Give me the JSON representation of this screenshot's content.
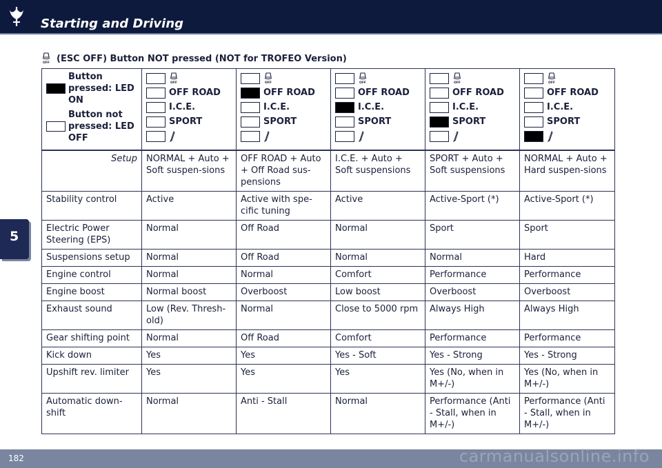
{
  "header": {
    "title": "Starting and Driving",
    "logo_icon": "trident-logo-icon"
  },
  "chapter": {
    "number": "5"
  },
  "footer": {
    "page_number": "182",
    "watermark": "carmanualsonline.info"
  },
  "section": {
    "heading": "(ESC OFF) Button NOT pressed (NOT for TROFEO Version)",
    "icon": "esc-off-icon"
  },
  "legend": {
    "pressed_label": "Button pressed: LED ON",
    "not_pressed_label": "Button not pressed: LED OFF"
  },
  "button_labels": {
    "off_road": "OFF ROAD",
    "ice": "I.C.E.",
    "sport": "SPORT"
  },
  "modes": [
    {
      "active": "none"
    },
    {
      "active": "off_road"
    },
    {
      "active": "ice"
    },
    {
      "active": "sport"
    },
    {
      "active": "suspension"
    }
  ],
  "table": {
    "rows": [
      {
        "label": "Setup",
        "cells": [
          "NORMAL + Auto + Soft suspen-sions",
          "OFF ROAD + Auto + Off Road sus-pensions",
          "I.C.E. + Auto + Soft suspensions",
          "SPORT + Auto + Soft suspensions",
          "NORMAL + Auto + Hard suspen-sions"
        ]
      },
      {
        "label": "Stability control",
        "cells": [
          "Active",
          "Active with spe-cific tuning",
          "Active",
          "Active-Sport (*)",
          "Active-Sport (*)"
        ]
      },
      {
        "label": "Electric Power Steering (EPS)",
        "cells": [
          "Normal",
          "Off Road",
          "Normal",
          "Sport",
          "Sport"
        ]
      },
      {
        "label": "Suspensions setup",
        "cells": [
          "Normal",
          "Off Road",
          "Normal",
          "Normal",
          "Hard"
        ]
      },
      {
        "label": "Engine control",
        "cells": [
          "Normal",
          "Normal",
          "Comfort",
          "Performance",
          "Performance"
        ]
      },
      {
        "label": "Engine boost",
        "cells": [
          "Normal boost",
          "Overboost",
          "Low boost",
          "Overboost",
          "Overboost"
        ]
      },
      {
        "label": "Exhaust sound",
        "cells": [
          "Low (Rev. Thresh-old)",
          "Normal",
          "Close to 5000 rpm",
          "Always High",
          "Always High"
        ]
      },
      {
        "label": "Gear shifting point",
        "cells": [
          "Normal",
          "Off Road",
          "Comfort",
          "Performance",
          "Performance"
        ]
      },
      {
        "label": "Kick down",
        "cells": [
          "Yes",
          "Yes",
          "Yes - Soft",
          "Yes - Strong",
          "Yes - Strong"
        ]
      },
      {
        "label": "Upshift rev. limiter",
        "cells": [
          "Yes",
          "Yes",
          "Yes",
          "Yes (No, when in M+/-)",
          "Yes (No, when in M+/-)"
        ]
      },
      {
        "label": "Automatic down-shift",
        "cells": [
          "Normal",
          "Anti - Stall",
          "Normal",
          "Performance (Anti - Stall, when in M+/-)",
          "Performance (Anti - Stall, when in M+/-)"
        ]
      }
    ]
  },
  "colors": {
    "header_bg": "#0e1a3d",
    "tab_bg": "#1e2a55",
    "footer_bg": "#7a869f"
  }
}
